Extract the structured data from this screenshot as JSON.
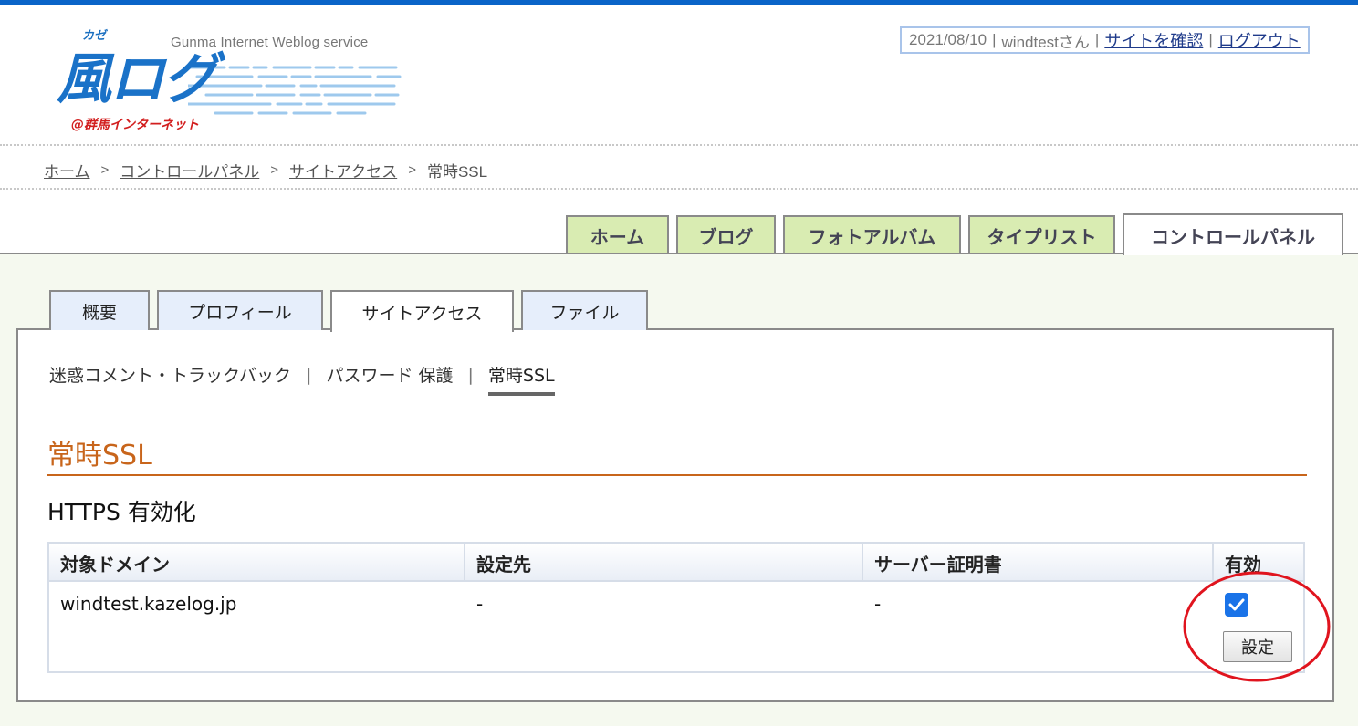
{
  "header": {
    "logo": {
      "service_tagline": "Gunma Internet Weblog service",
      "furigana": "カゼ",
      "brand": "風ログ",
      "provider": "@群馬インターネット"
    },
    "user_box": {
      "date": "2021/08/10",
      "user": "windtestさん",
      "view_site_link": "サイトを確認",
      "logout_link": "ログアウト"
    }
  },
  "breadcrumb": {
    "items": [
      "ホーム",
      "コントロールパネル",
      "サイトアクセス"
    ],
    "current": "常時SSL"
  },
  "main_tabs": [
    {
      "label": "ホーム",
      "active": false
    },
    {
      "label": "ブログ",
      "active": false
    },
    {
      "label": "フォトアルバム",
      "active": false
    },
    {
      "label": "タイプリスト",
      "active": false
    },
    {
      "label": "コントロールパネル",
      "active": true
    }
  ],
  "sub_tabs": [
    {
      "label": "概要",
      "active": false
    },
    {
      "label": "プロフィール",
      "active": false
    },
    {
      "label": "サイトアクセス",
      "active": true
    },
    {
      "label": "ファイル",
      "active": false
    }
  ],
  "subnav": {
    "items": [
      "迷惑コメント・トラックバック",
      "パスワード 保護"
    ],
    "current": "常時SSL"
  },
  "section": {
    "title": "常時SSL",
    "subheading": "HTTPS 有効化"
  },
  "table": {
    "headers": [
      "対象ドメイン",
      "設定先",
      "サーバー証明書",
      "有効"
    ],
    "rows": [
      {
        "domain": "windtest.kazelog.jp",
        "target": "-",
        "certificate": "-",
        "enabled": true
      }
    ],
    "submit_label": "設定"
  },
  "colors": {
    "top_bar": "#0a64c8",
    "main_tab_bg": "#d9ecb2",
    "sub_tab_bg": "#e6eefb",
    "content_bg": "#f5f9ef",
    "section_title": "#c8651b",
    "annotation_circle": "#e0141e",
    "checkbox": "#1a73e8"
  }
}
